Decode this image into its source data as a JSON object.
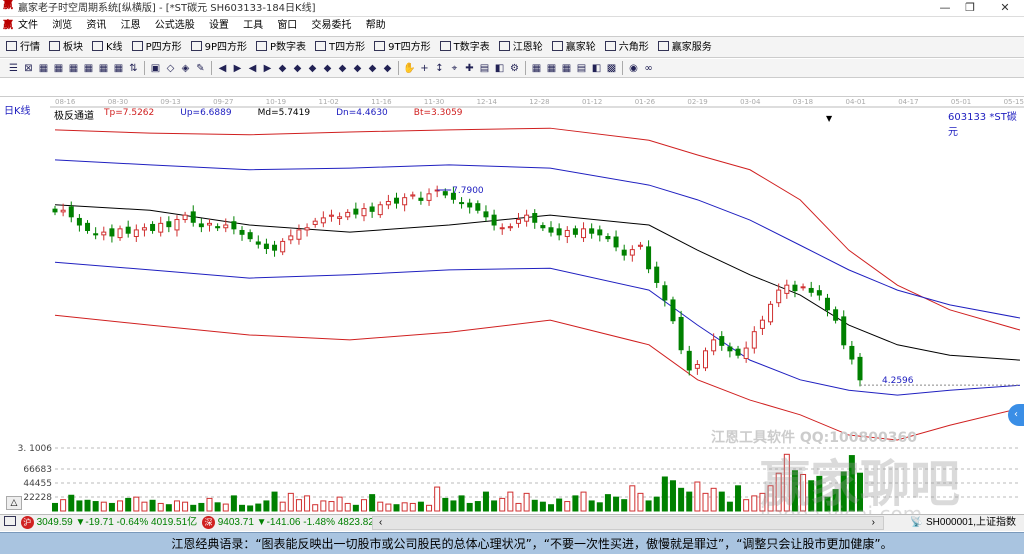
{
  "window": {
    "title": "赢家老子时空周期系统[纵横版] - [*ST碳元  SH603133-184日K线]"
  },
  "menu": [
    "文件",
    "浏览",
    "资讯",
    "江恩",
    "公式选股",
    "设置",
    "工具",
    "窗口",
    "交易委托",
    "帮助"
  ],
  "toolbar": [
    {
      "icon": "grid",
      "label": "行情"
    },
    {
      "icon": "blocks",
      "label": "板块"
    },
    {
      "icon": "candles",
      "label": "K线"
    },
    {
      "icon": "PS",
      "label": "P四方形"
    },
    {
      "icon": "P9",
      "label": "9P四方形"
    },
    {
      "icon": "PN",
      "label": "P数字表"
    },
    {
      "icon": "TS",
      "label": "T四方形"
    },
    {
      "icon": "T9",
      "label": "9T四方形"
    },
    {
      "icon": "TN",
      "label": "T数字表"
    },
    {
      "icon": "target",
      "label": "江恩轮"
    },
    {
      "icon": "wheel",
      "label": "赢家轮"
    },
    {
      "icon": "hexagon",
      "label": "六角形"
    },
    {
      "icon": "dollar",
      "label": "赢家服务"
    }
  ],
  "chart": {
    "period_label": "日K线",
    "indicator_name": "极反通道",
    "params": [
      {
        "text": "Tp=7.5262",
        "color": "#d02020"
      },
      {
        "text": "Up=6.6889",
        "color": "#2020c0"
      },
      {
        "text": "Md=5.7419",
        "color": "#000000"
      },
      {
        "text": "Dn=4.4630",
        "color": "#2020c0"
      },
      {
        "text": "Bt=3.3059",
        "color": "#d02020"
      }
    ],
    "stock": "603133 *ST碳元",
    "high_label": "7.7900",
    "low_label": "4.2596",
    "volume_label": "3. 1006",
    "volume_ticks": [
      "66683",
      "44455",
      "22228"
    ],
    "watermark_1": "江恩工具软件  QQ:100800360",
    "watermark_2": "赢家聊吧",
    "watermark_3": "jiaoba.yicai.com"
  },
  "chart_data": {
    "type": "candlestick",
    "dates": [
      "08-16",
      "08-30",
      "09-13",
      "09-27",
      "10-19",
      "11-02",
      "11-16",
      "11-30",
      "12-14",
      "12-28",
      "01-12",
      "01-26",
      "02-19",
      "03-04",
      "03-18",
      "04-01",
      "04-17",
      "05-01",
      "05-15"
    ],
    "closes": [
      7.39,
      7.42,
      7.3,
      7.15,
      7.05,
      6.97,
      7.02,
      6.95,
      7.08,
      7.0,
      7.06,
      7.1,
      7.05,
      7.18,
      7.12,
      7.25,
      7.33,
      7.2,
      7.12,
      7.18,
      7.1,
      7.15,
      7.08,
      6.98,
      6.9,
      6.8,
      6.72,
      6.69,
      6.85,
      6.95,
      7.06,
      7.1,
      7.22,
      7.28,
      7.33,
      7.3,
      7.38,
      7.35,
      7.45,
      7.4,
      7.52,
      7.58,
      7.55,
      7.65,
      7.7,
      7.6,
      7.72,
      7.79,
      7.7,
      7.62,
      7.55,
      7.48,
      7.42,
      7.3,
      7.15,
      7.1,
      7.12,
      7.25,
      7.33,
      7.2,
      7.1,
      7.02,
      6.97,
      7.05,
      6.98,
      7.08,
      7.0,
      6.97,
      6.9,
      6.75,
      6.6,
      6.7,
      6.78,
      6.35,
      6.1,
      5.78,
      5.4,
      4.87,
      4.5,
      4.6,
      4.85,
      5.05,
      4.95,
      4.85,
      4.77,
      4.9,
      5.2,
      5.41,
      5.7,
      5.96,
      6.05,
      5.95,
      6.02,
      5.92,
      5.87,
      5.6,
      5.41,
      4.96,
      4.7,
      4.32
    ],
    "volumes": [
      12000,
      18000,
      25000,
      16000,
      17000,
      15000,
      14000,
      12000,
      16000,
      20000,
      22000,
      14000,
      17000,
      12000,
      10000,
      16000,
      14000,
      9000,
      12000,
      20000,
      13000,
      11000,
      24000,
      9000,
      8000,
      11000,
      16000,
      30000,
      14000,
      28000,
      18000,
      24000,
      10000,
      16000,
      15000,
      22000,
      12000,
      9000,
      18000,
      26000,
      14000,
      11000,
      10000,
      13000,
      12000,
      14000,
      9000,
      38000,
      20000,
      16000,
      24000,
      12000,
      15000,
      30000,
      16000,
      20000,
      30000,
      12000,
      28000,
      17000,
      14000,
      10000,
      19000,
      15000,
      24000,
      30000,
      16000,
      13000,
      26000,
      22000,
      18000,
      40000,
      28000,
      16000,
      22000,
      54000,
      48000,
      36000,
      30000,
      46000,
      28000,
      36000,
      30000,
      14000,
      40000,
      18000,
      24000,
      28000,
      40000,
      60000,
      90000,
      64000,
      58000,
      48000,
      55000,
      22000,
      34000,
      62000,
      88000,
      60000
    ],
    "bands": {
      "positions": [
        0,
        17.6,
        36,
        54.6,
        73,
        91.7,
        110,
        119,
        128.7,
        138,
        147,
        156,
        165.7,
        178.7
      ],
      "Tp": [
        8.89,
        8.83,
        8.8,
        8.85,
        8.89,
        8.92,
        8.7,
        8.43,
        8.16,
        7.61,
        6.69,
        6.05,
        5.6,
        5.23
      ],
      "Up": [
        8.34,
        8.25,
        8.16,
        8.19,
        8.25,
        8.19,
        7.88,
        7.61,
        7.24,
        6.78,
        6.33,
        5.96,
        5.69,
        5.45
      ],
      "Md": [
        7.52,
        7.42,
        7.15,
        7.02,
        7.15,
        7.33,
        7.15,
        6.69,
        6.24,
        5.87,
        5.32,
        4.96,
        4.77,
        4.68
      ],
      "Dn": [
        6.47,
        6.33,
        6.18,
        6.24,
        6.33,
        6.36,
        5.96,
        5.32,
        4.68,
        4.32,
        4.13,
        4.04,
        4.13,
        4.22
      ],
      "Bt": [
        5.5,
        5.32,
        5.14,
        5.05,
        5.19,
        5.41,
        4.96,
        4.32,
        3.95,
        3.68,
        3.31,
        3.22,
        3.49,
        3.8
      ]
    },
    "colors": {
      "up": "#d03030",
      "down": "#008000",
      "Tp": "#d02020",
      "Up": "#2020c0",
      "Md": "#000000",
      "Dn": "#2020c0",
      "Bt": "#d02020"
    }
  },
  "status": {
    "sh_index": "3049.59",
    "sh_change": "▼-19.71",
    "sh_pct": "-0.64%",
    "sh_amount": "4019.51亿",
    "sz_index": "9403.71",
    "sz_change": "▼-141.06",
    "sz_pct": "-1.48%",
    "sz_amount": "4823.82",
    "index_code": "SH000001,上证指数"
  },
  "quote": "江恩经典语录：“图表能反映出一切股市或公司股民的总体心理状况”，“不要一次性买进，傲慢就是罪过”，“调整只会让股市更加健康”。"
}
